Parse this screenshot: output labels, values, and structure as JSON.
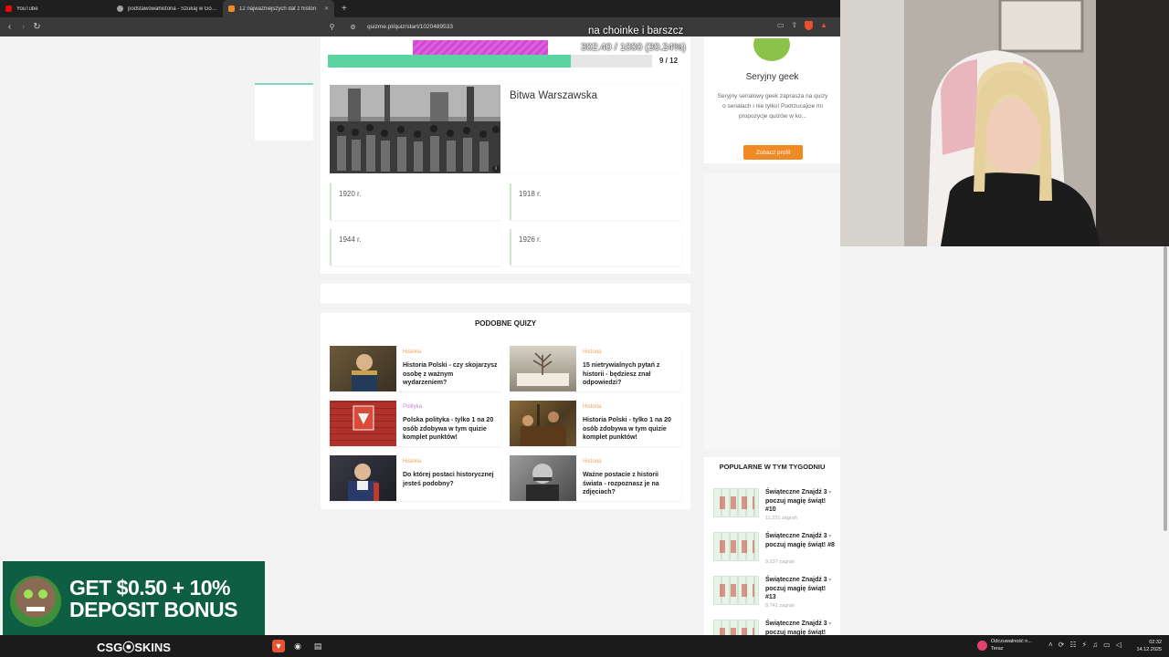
{
  "browser": {
    "tabs": [
      {
        "label": "YouTube",
        "color": "#ff0000"
      },
      {
        "label": "podstawowahistoria - Szukaj w Goog",
        "color": "#9e9e9e"
      },
      {
        "label": "12 najważniejszych dat z histori",
        "color": "#f08a24",
        "active": true
      }
    ],
    "new_tab": "+",
    "url": "quizme.pl/quiz/start/1020489533"
  },
  "overlay": {
    "title": "na choinke i barszcz",
    "progress_text": "302.40 / 1000 (30.24%)",
    "progress_fraction": 0.3024
  },
  "quiz": {
    "progress_fraction": 0.75,
    "counter": "9 / 12",
    "question": "Bitwa Warszawska",
    "answers": [
      "1920 r.",
      "1918 r.",
      "1944 r.",
      "1926 r."
    ]
  },
  "similar": {
    "title": "PODOBNE QUIZY",
    "items": [
      {
        "category": "Historia",
        "title": "Historia Polski - czy skojarzysz osobę z ważnym wydarzeniem?"
      },
      {
        "category": "Historia",
        "title": "15 nietrywialnych pytań z historii - będziesz znał odpowiedzi?"
      },
      {
        "category": "Polityka",
        "title": "Polska polityka - tylko 1 na 20 osób zdobywa w tym quizie komplet punktów!"
      },
      {
        "category": "Historia",
        "title": "Historia Polski - tylko 1 na 20 osób zdobywa w tym quizie komplet punktów!"
      },
      {
        "category": "Historia",
        "title": "Do której postaci historycznej jesteś podobny?"
      },
      {
        "category": "Historia",
        "title": "Ważne postacie z historii świata - rozpoznasz je na zdjęciach?"
      }
    ],
    "category_colors": {
      "Historia": "#f0a35a",
      "Polityka": "#d07ad6"
    }
  },
  "profile": {
    "name": "Seryjny geek",
    "description": "Seryjny serialowy geek zaprasza na quizy o serialach i nie tylko! Podrzucajcie mi propozycje quizów w ko...",
    "button": "Zobacz profil"
  },
  "popular": {
    "title": "POPULARNE W TYM TYGODNIU",
    "items": [
      {
        "title": "Świąteczne Znajdź 3 - poczuj magię świąt! #10",
        "meta": "11,231 zagrań"
      },
      {
        "title": "Świąteczne Znajdź 3 - poczuj magię świąt! #8",
        "meta": "9,237 zagrań"
      },
      {
        "title": "Świąteczne Znajdź 3 - poczuj magię świąt! #13",
        "meta": "8,741 zagrań"
      },
      {
        "title": "Świąteczne Znajdź 3 - poczuj magię świąt!",
        "meta": ""
      }
    ]
  },
  "promo": {
    "line1": "GET $0.50 + 10%",
    "line2": "DEPOSIT BONUS",
    "brand": "CSG⦿SKINS"
  },
  "taskbar": {
    "notification_title": "Odczuwalność n...",
    "notification_sub": "Teraz",
    "time": "02:32",
    "date": "14.12.2025"
  }
}
